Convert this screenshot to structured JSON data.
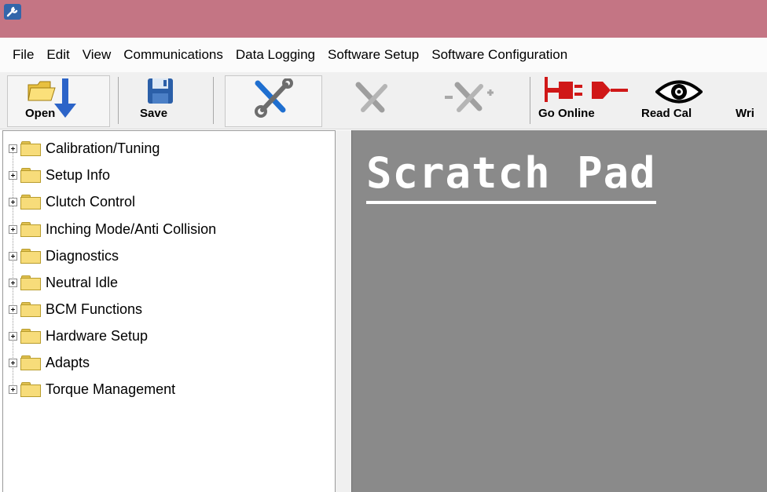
{
  "window": {
    "app_icon": "wrench-app-icon"
  },
  "menu": [
    "File",
    "Edit",
    "View",
    "Communications",
    "Data Logging",
    "Software Setup",
    "Software Configuration"
  ],
  "toolbar": {
    "open_label": "Open",
    "save_label": "Save",
    "go_online_label": "Go Online",
    "read_cal_label": "Read Cal",
    "write_label": "Wri"
  },
  "tree": [
    "Calibration/Tuning",
    "Setup Info",
    "Clutch Control",
    "Inching Mode/Anti Collision",
    "Diagnostics",
    "Neutral Idle",
    "BCM Functions",
    "Hardware Setup",
    "Adapts",
    "Torque Management"
  ],
  "scratch_pad": {
    "title": "Scratch Pad"
  },
  "colors": {
    "titlebar": "#c47584",
    "scratch_bg": "#8a8a8a",
    "folder": "#f7dc7a"
  }
}
